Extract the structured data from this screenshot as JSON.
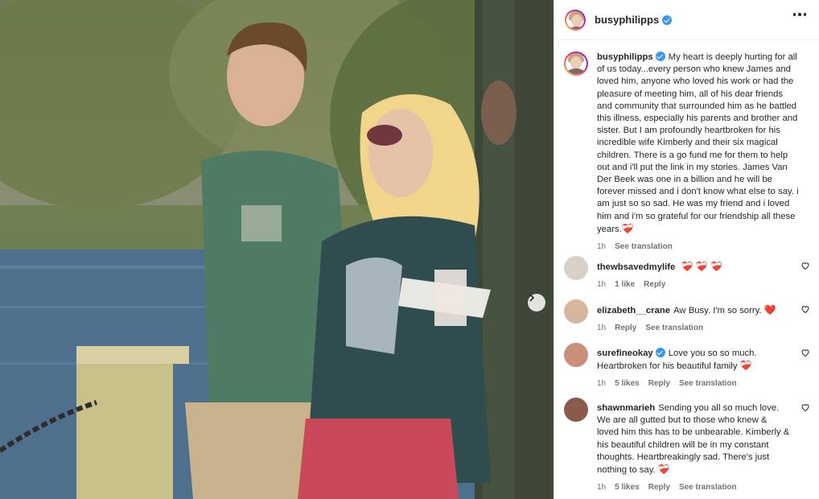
{
  "post": {
    "author": "busyphilipps",
    "verified": true,
    "caption": "My heart is deeply hurting for all of us today...every person who knew James and loved him, anyone who loved his work or had the pleasure of meeting him, all of his dear friends and community that surrounded him as he battled this illness, especially his parents and brother and sister. But I am profoundly heartbroken for his incredible wife Kimberly and their six magical children. There is a go fund me for them to help out and i'll put the link in my stories. James Van Der Beek was one in a billion and he will be forever missed and i don't know what else to say. i am just so so sad. He was my friend and i loved him and i'm so grateful for our friendship all these years.",
    "caption_emoji": "❤️‍🩹",
    "time": "1h",
    "see_translation": "See translation"
  },
  "comments": [
    {
      "username": "thewbsavedmylife",
      "verified": false,
      "text": "",
      "emoji": "❤️‍🩹 ❤️‍🩹 ❤️‍🩹",
      "time": "1h",
      "likes": "1 like",
      "reply": "Reply",
      "translation": ""
    },
    {
      "username": "elizabeth__crane",
      "verified": false,
      "text": "Aw Busy. I'm so sorry.",
      "emoji": "❤️",
      "time": "1h",
      "likes": "",
      "reply": "Reply",
      "translation": "See translation"
    },
    {
      "username": "surefineokay",
      "verified": true,
      "text": "Love you so so much. Heartbroken for his beautiful family",
      "emoji": "❤️‍🩹",
      "time": "1h",
      "likes": "5 likes",
      "reply": "Reply",
      "translation": "See translation"
    },
    {
      "username": "shawnmarieh",
      "verified": false,
      "text": "Sending you all so much love. We are all gutted but to those who knew & loved him this has to be unbearable. Kimberly & his beautiful children will be in my constant thoughts. Heartbreakingly sad. There's just nothing to say.",
      "emoji": "❤️‍🩹",
      "time": "1h",
      "likes": "5 likes",
      "reply": "Reply",
      "translation": "See translation"
    }
  ],
  "colors": {
    "accent_verified": "#3897f0",
    "heart": "#e0245e",
    "secondary_text": "#737373"
  },
  "icons": {
    "more": "more-options-icon",
    "next": "chevron-right-icon",
    "like": "heart-outline-icon"
  }
}
